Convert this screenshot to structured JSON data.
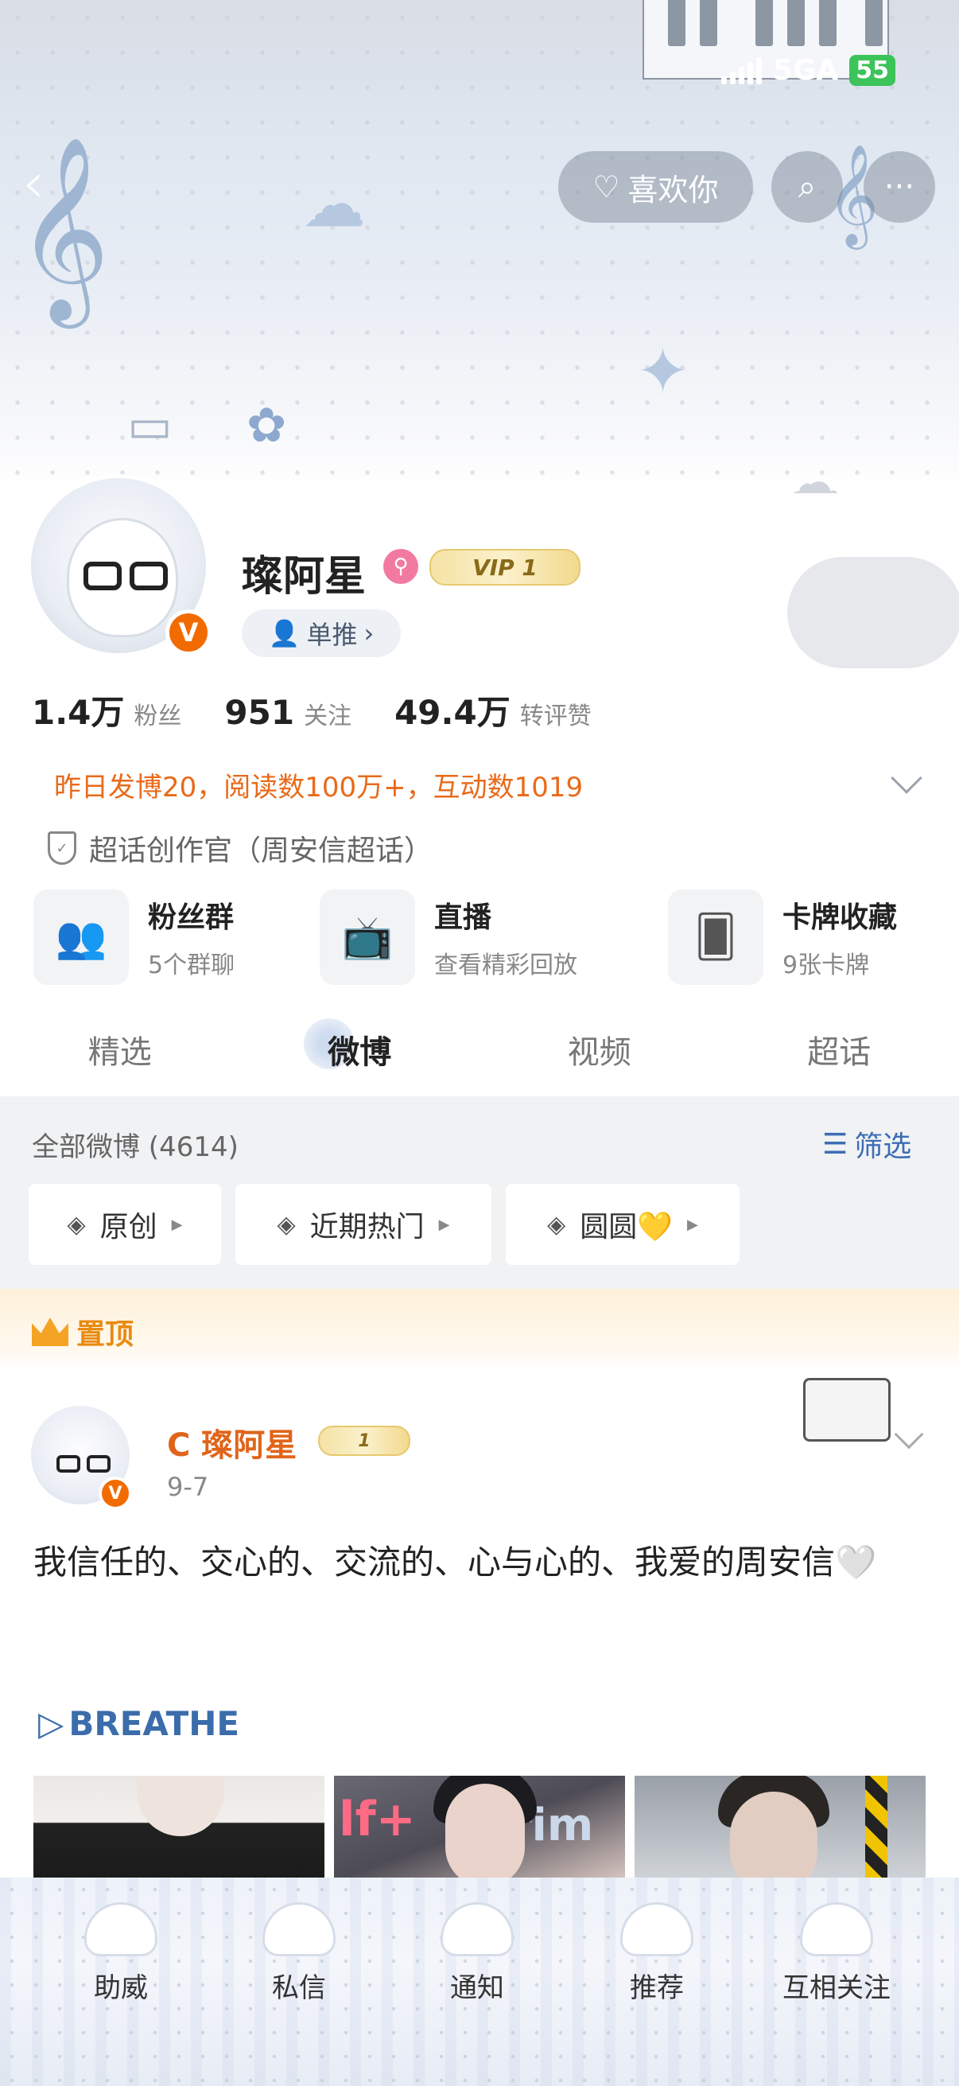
{
  "status": {
    "network": "5GA",
    "battery": "55"
  },
  "header": {
    "like_label": "喜欢你"
  },
  "profile": {
    "name": "璨阿星",
    "vip_label": "VIP 1",
    "v_badge": "V",
    "dantui_label": "单推",
    "stats": [
      {
        "value": "1.4万",
        "label": "粉丝"
      },
      {
        "value": "951",
        "label": "关注"
      },
      {
        "value": "49.4万",
        "label": "转评赞"
      }
    ],
    "daily": "昨日发博20，阅读数100万+，互动数1019",
    "creator": "超话创作官（周安信超话）"
  },
  "features": [
    {
      "title": "粉丝群",
      "sub": "5个群聊",
      "icon": "group-icon"
    },
    {
      "title": "直播",
      "sub": "查看精彩回放",
      "icon": "tv-icon"
    },
    {
      "title": "卡牌收藏",
      "sub": "9张卡牌",
      "icon": "card-icon"
    }
  ],
  "tabs": [
    "精选",
    "微博",
    "视频",
    "超话"
  ],
  "active_tab": "微博",
  "feed": {
    "all_label": "全部微博 (4614)",
    "filter_label": "筛选",
    "chips": [
      "原创",
      "近期热门",
      "圆圆💛"
    ]
  },
  "pinned": {
    "label": "置顶",
    "author": "C 璨阿星",
    "level": "1",
    "date": "9-7",
    "text": "我信任的、交心的、交流的、心与心的、我爱的周安信🤍",
    "link": "BREATHE"
  },
  "bottom_nav": [
    "助威",
    "私信",
    "通知",
    "推荐",
    "互相关注"
  ],
  "colors": {
    "accent": "#e96a1a",
    "link": "#3b6cab",
    "v_orange": "#f26b00",
    "pinned_gold": "#e98b12"
  }
}
